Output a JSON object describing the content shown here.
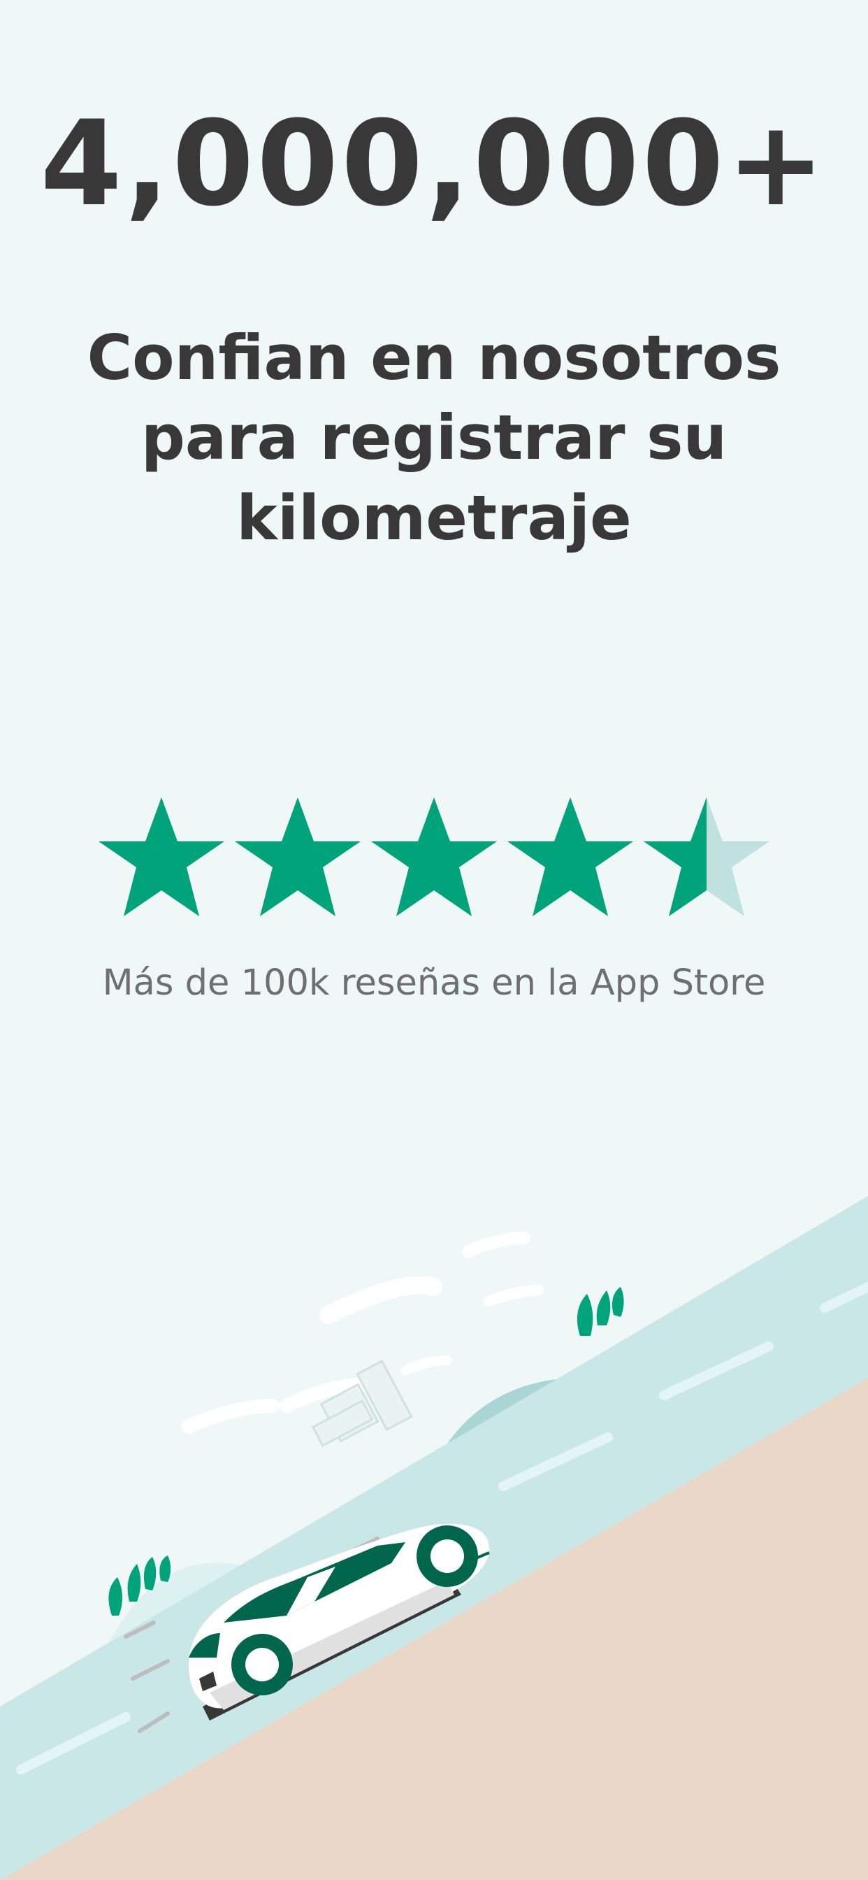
{
  "hero": {
    "number": "4,000,000+",
    "subtitle": "Confian en nosotros para registrar su kilometraje"
  },
  "rating": {
    "value": 4.5,
    "max": 5,
    "reviews_text": "Más de 100k reseñas en la App Store"
  },
  "colors": {
    "background": "#eff8f7",
    "text_dark": "#383838",
    "text_muted": "#6f6f6f",
    "accent_green": "#00a37a",
    "star_empty": "#bfe1e0",
    "road": "#cae7e7",
    "ground": "#e9d8c8",
    "car_dark_green": "#00674d"
  }
}
